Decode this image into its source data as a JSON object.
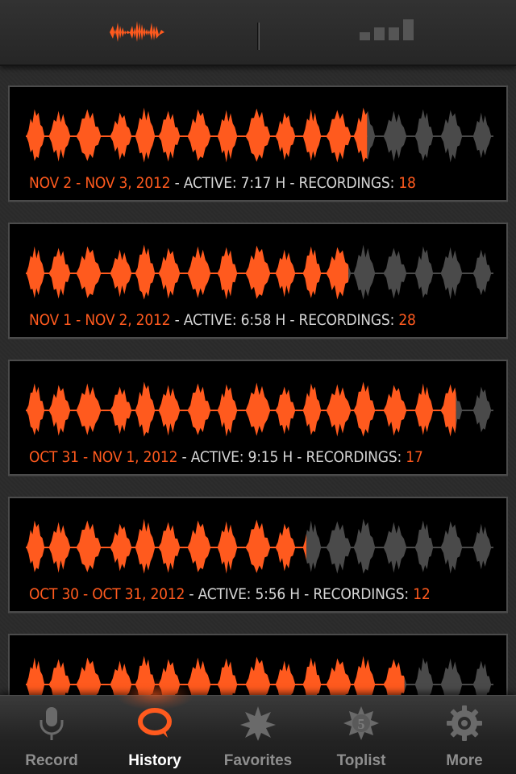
{
  "colors": {
    "accent": "#ff5a1e",
    "inactive_wave": "#4a4a4a",
    "caption_text": "#d6d6d6"
  },
  "topbar": {
    "buttons": [
      {
        "name": "waveform-view-icon",
        "state": "selected"
      },
      {
        "name": "divider"
      },
      {
        "name": "level-bars-icon",
        "state": "unselected"
      }
    ]
  },
  "history": [
    {
      "date_range": "NOV 2 - NOV 3, 2012",
      "active_label": " - ACTIVE: ",
      "active_value": "7:17 H",
      "recordings_label": " - RECORDINGS: ",
      "recordings": "18",
      "recorded_fraction": 0.73
    },
    {
      "date_range": "NOV 1 - NOV 2, 2012",
      "active_label": " - ACTIVE: ",
      "active_value": "6:58 H",
      "recordings_label": " - RECORDINGS: ",
      "recordings": "28",
      "recorded_fraction": 0.69
    },
    {
      "date_range": "OCT 31 - NOV 1, 2012",
      "active_label": " - ACTIVE: ",
      "active_value": "9:15 H",
      "recordings_label": " - RECORDINGS: ",
      "recordings": "17",
      "recorded_fraction": 0.92
    },
    {
      "date_range": "OCT 30 - OCT 31, 2012",
      "active_label": " - ACTIVE: ",
      "active_value": "5:56 H",
      "recordings_label": " - RECORDINGS: ",
      "recordings": "12",
      "recorded_fraction": 0.6
    },
    {
      "date_range": "",
      "active_label": "",
      "active_value": "",
      "recordings_label": "",
      "recordings": "",
      "recorded_fraction": 0.81
    }
  ],
  "tabs": [
    {
      "label": "Record",
      "icon": "microphone-icon",
      "active": false
    },
    {
      "label": "History",
      "icon": "speech-bubble-icon",
      "active": true
    },
    {
      "label": "Favorites",
      "icon": "star-badge-icon",
      "active": false
    },
    {
      "label": "Toplist",
      "icon": "number-badge-icon",
      "active": false
    },
    {
      "label": "More",
      "icon": "gear-icon",
      "active": false
    }
  ]
}
